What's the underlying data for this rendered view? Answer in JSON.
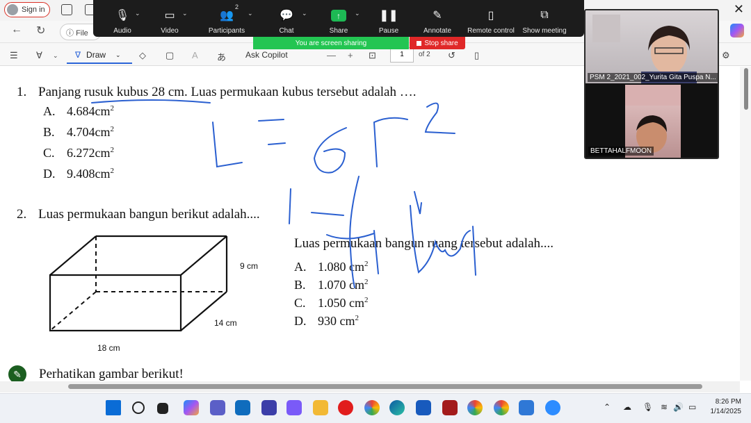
{
  "browser": {
    "signin_label": "Sign in",
    "address_partial": "File",
    "close_glyph": "✕"
  },
  "zoom_toolbar": {
    "items": [
      {
        "label": "Audio",
        "icon": "microphone-icon"
      },
      {
        "label": "Video",
        "icon": "video-camera-icon"
      },
      {
        "label": "Participants",
        "icon": "participants-icon",
        "count": "2"
      },
      {
        "label": "Chat",
        "icon": "chat-icon"
      },
      {
        "label": "Share",
        "icon": "share-screen-icon"
      },
      {
        "label": "Pause",
        "icon": "pause-icon"
      },
      {
        "label": "Annotate",
        "icon": "pen-icon"
      },
      {
        "label": "Remote control",
        "icon": "mouse-icon"
      },
      {
        "label": "Show meeting",
        "icon": "show-meeting-icon"
      }
    ],
    "sharing_status": "You are screen sharing",
    "stop_share_label": "Stop share"
  },
  "pdf_toolbar": {
    "draw_label": "Draw",
    "ask_copilot": "Ask Copilot",
    "current_page": "1",
    "total_pages": "of 2"
  },
  "document": {
    "q1": {
      "number": "1.",
      "text": "Panjang rusuk kubus 28 cm. Luas permukaan kubus tersebut adalah ….",
      "options": [
        {
          "letter": "A.",
          "value": "4.684cm",
          "sup": "2"
        },
        {
          "letter": "B.",
          "value": "4.704cm",
          "sup": "2"
        },
        {
          "letter": "C.",
          "value": "6.272cm",
          "sup": "2"
        },
        {
          "letter": "D.",
          "value": "9.408cm",
          "sup": "2"
        }
      ]
    },
    "q2": {
      "number": "2.",
      "text": "Luas permukaan bangun berikut adalah....",
      "subtext": "Luas permukaan bangun ruang tersebut adalah....",
      "dimensions": {
        "height": "9 cm",
        "depth": "14 cm",
        "length": "18 cm"
      },
      "options": [
        {
          "letter": "A.",
          "value": "1.080 cm",
          "sup": "2"
        },
        {
          "letter": "B.",
          "value": "1.070 cm",
          "sup": "2"
        },
        {
          "letter": "C.",
          "value": "1.050 cm",
          "sup": "2"
        },
        {
          "letter": "D.",
          "value": "930 cm",
          "sup": "2"
        }
      ]
    },
    "q3_partial": "Perhatikan gambar berikut!"
  },
  "video_panel": {
    "participant1": "PSM 2_2021_002_Yurita Gita Puspa N...",
    "participant2": "BETTAHALFMOON"
  },
  "taskbar": {
    "time": "8:26 PM",
    "date": "1/14/2025"
  },
  "colors": {
    "zoom_bg": "#1c1c1c",
    "sharing_green": "#23c552",
    "stop_red": "#e02828",
    "ink_blue": "#2a5fd0"
  }
}
